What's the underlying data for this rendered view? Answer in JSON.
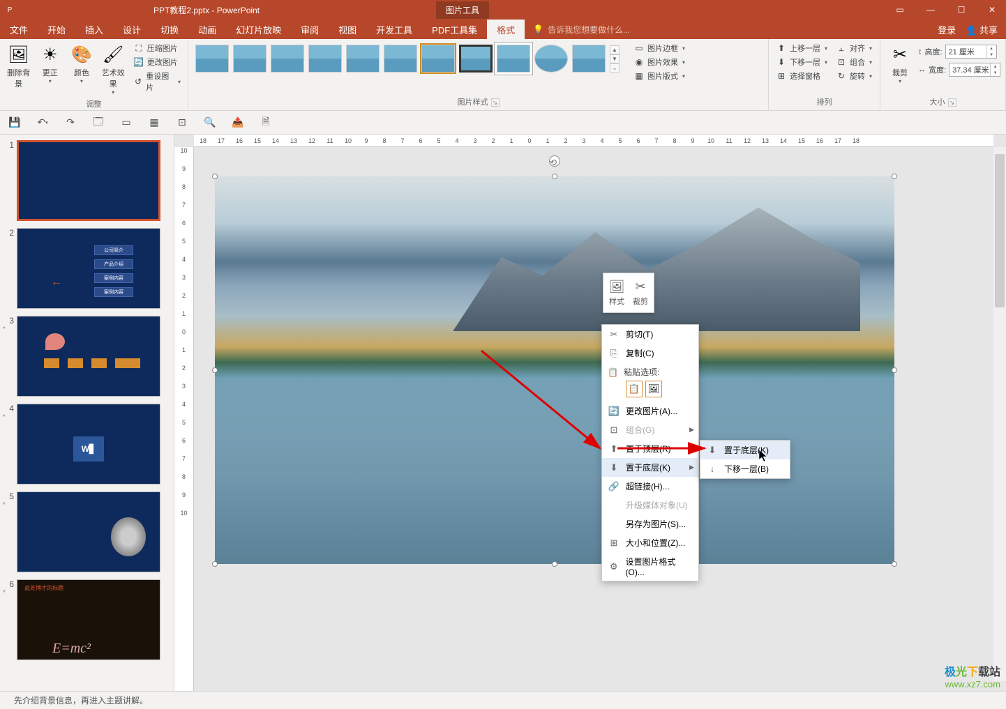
{
  "title_bar": {
    "document": "PPT教程2.pptx - PowerPoint",
    "contextual_tab": "图片工具",
    "login": "登录",
    "share": "共享"
  },
  "tabs": {
    "file": "文件",
    "home": "开始",
    "insert": "插入",
    "design": "设计",
    "transitions": "切换",
    "animations": "动画",
    "slideshow": "幻灯片放映",
    "review": "审阅",
    "view": "视图",
    "developer": "开发工具",
    "pdf": "PDF工具集",
    "format": "格式",
    "tell_me_placeholder": "告诉我您想要做什么..."
  },
  "ribbon": {
    "adjust": {
      "remove_bg": "删除背景",
      "corrections": "更正",
      "color": "颜色",
      "artistic": "艺术效果",
      "compress": "压缩图片",
      "change": "更改图片",
      "reset": "重设图片",
      "group_label": "调整"
    },
    "styles": {
      "border": "图片边框",
      "effects": "图片效果",
      "layout": "图片版式",
      "group_label": "图片样式"
    },
    "arrange": {
      "bring_forward": "上移一层",
      "send_backward": "下移一层",
      "selection_pane": "选择窗格",
      "align": "对齐",
      "group": "组合",
      "rotate": "旋转",
      "group_label": "排列"
    },
    "size": {
      "crop": "裁剪",
      "height_label": "高度:",
      "height_value": "21 厘米",
      "width_label": "宽度:",
      "width_value": "37.34 厘米",
      "group_label": "大小"
    }
  },
  "mini_toolbar": {
    "style": "样式",
    "crop": "裁剪"
  },
  "context_menu": {
    "cut": "剪切(T)",
    "copy": "复制(C)",
    "paste_label": "粘贴选项:",
    "change_picture": "更改图片(A)...",
    "group": "组合(G)",
    "bring_to_front": "置于顶层(R)",
    "send_to_back": "置于底层(K)",
    "hyperlink": "超链接(H)...",
    "upgrade_media": "升级媒体对象(U)",
    "save_as_picture": "另存为图片(S)...",
    "size_position": "大小和位置(Z)...",
    "format_picture": "设置图片格式(O)..."
  },
  "submenu": {
    "send_to_back": "置于底层(K)",
    "send_backward": "下移一层(B)"
  },
  "slide2_items": [
    "公司简介",
    "产品介绍",
    "案例内容",
    "案例内容"
  ],
  "ruler_marks": [
    "18",
    "17",
    "16",
    "15",
    "14",
    "13",
    "12",
    "11",
    "10",
    "9",
    "8",
    "7",
    "6",
    "5",
    "4",
    "3",
    "2",
    "1",
    "0",
    "1",
    "2",
    "3",
    "4",
    "5",
    "6",
    "7",
    "8",
    "9",
    "10",
    "11",
    "12",
    "13",
    "14",
    "15",
    "16",
    "17",
    "18"
  ],
  "ruler_v_marks": [
    "10",
    "9",
    "8",
    "7",
    "6",
    "5",
    "4",
    "3",
    "2",
    "1",
    "0",
    "1",
    "2",
    "3",
    "4",
    "5",
    "6",
    "7",
    "8",
    "9",
    "10"
  ],
  "status": {
    "notes": "先介绍背景信息，再进入主题讲解。"
  },
  "watermark": {
    "brand": "极光下载站",
    "url": "www.xz7.com"
  }
}
